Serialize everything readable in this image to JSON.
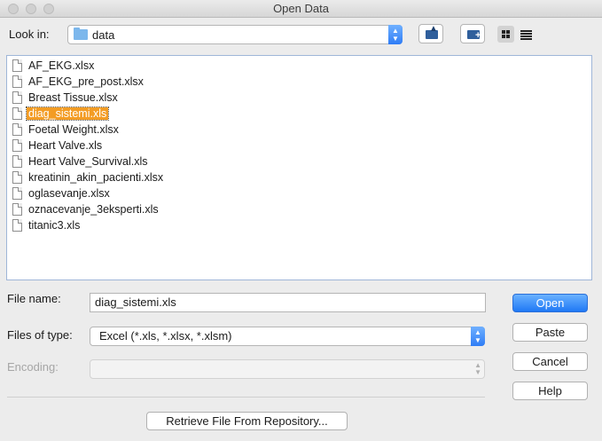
{
  "window": {
    "title": "Open Data"
  },
  "lookin": {
    "label": "Look in:",
    "value": "data"
  },
  "toolbar": {
    "up_icon": "folder-up-icon",
    "new_folder_icon": "new-folder-icon",
    "grid_view_icon": "grid-view-icon",
    "list_view_icon": "list-view-icon"
  },
  "files": [
    {
      "name": "AF_EKG.xlsx"
    },
    {
      "name": "AF_EKG_pre_post.xlsx"
    },
    {
      "name": "Breast Tissue.xlsx"
    },
    {
      "name": "diag_sistemi.xls"
    },
    {
      "name": "Foetal Weight.xlsx"
    },
    {
      "name": "Heart Valve.xls"
    },
    {
      "name": "Heart Valve_Survival.xls"
    },
    {
      "name": "kreatinin_akin_pacienti.xlsx"
    },
    {
      "name": "oglasevanje.xlsx"
    },
    {
      "name": "oznacevanje_3eksperti.xls"
    },
    {
      "name": "titanic3.xls"
    }
  ],
  "selected_file_index": 3,
  "form": {
    "filename_label": "File name:",
    "filename_value": "diag_sistemi.xls",
    "filetype_label": "Files of type:",
    "filetype_value": "Excel (*.xls, *.xlsx, *.xlsm)",
    "encoding_label": "Encoding:",
    "encoding_value": ""
  },
  "buttons": {
    "open": "Open",
    "paste": "Paste",
    "cancel": "Cancel",
    "help": "Help",
    "retrieve": "Retrieve File From Repository..."
  },
  "colors": {
    "accent": "#2f7df6",
    "selection": "#f39c24"
  }
}
